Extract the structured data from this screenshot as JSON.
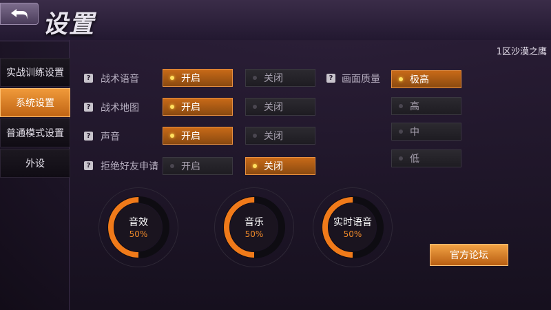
{
  "header": {
    "title": "设置",
    "server": "1区沙漠之鹰"
  },
  "sidebar": {
    "items": [
      {
        "label": "实战训练设置",
        "active": false
      },
      {
        "label": "系统设置",
        "active": true
      },
      {
        "label": "普通模式设置",
        "active": false
      },
      {
        "label": "外设",
        "active": false
      }
    ]
  },
  "settings": {
    "rows": [
      {
        "label": "战术语音",
        "options": [
          {
            "label": "开启",
            "on": true
          },
          {
            "label": "关闭",
            "on": false
          }
        ]
      },
      {
        "label": "战术地图",
        "options": [
          {
            "label": "开启",
            "on": true
          },
          {
            "label": "关闭",
            "on": false
          }
        ]
      },
      {
        "label": "声音",
        "options": [
          {
            "label": "开启",
            "on": true
          },
          {
            "label": "关闭",
            "on": false
          }
        ]
      },
      {
        "label": "拒绝好友申请",
        "options": [
          {
            "label": "开启",
            "on": false
          },
          {
            "label": "关闭",
            "on": true
          }
        ]
      }
    ],
    "quality": {
      "label": "画面质量",
      "options": [
        {
          "label": "极高",
          "on": true
        },
        {
          "label": "高",
          "on": false
        },
        {
          "label": "中",
          "on": false
        },
        {
          "label": "低",
          "on": false
        }
      ]
    }
  },
  "help_glyph": "?",
  "dials": [
    {
      "name": "音效",
      "value": "50%",
      "fraction": 0.5
    },
    {
      "name": "音乐",
      "value": "50%",
      "fraction": 0.5
    },
    {
      "name": "实时语音",
      "value": "50%",
      "fraction": 0.5
    }
  ],
  "forum_button": {
    "label": "官方论坛"
  },
  "colors": {
    "accent": "#f08a2a",
    "dial_track": "#0e0c12",
    "dial_fill": "#f07a1a"
  }
}
